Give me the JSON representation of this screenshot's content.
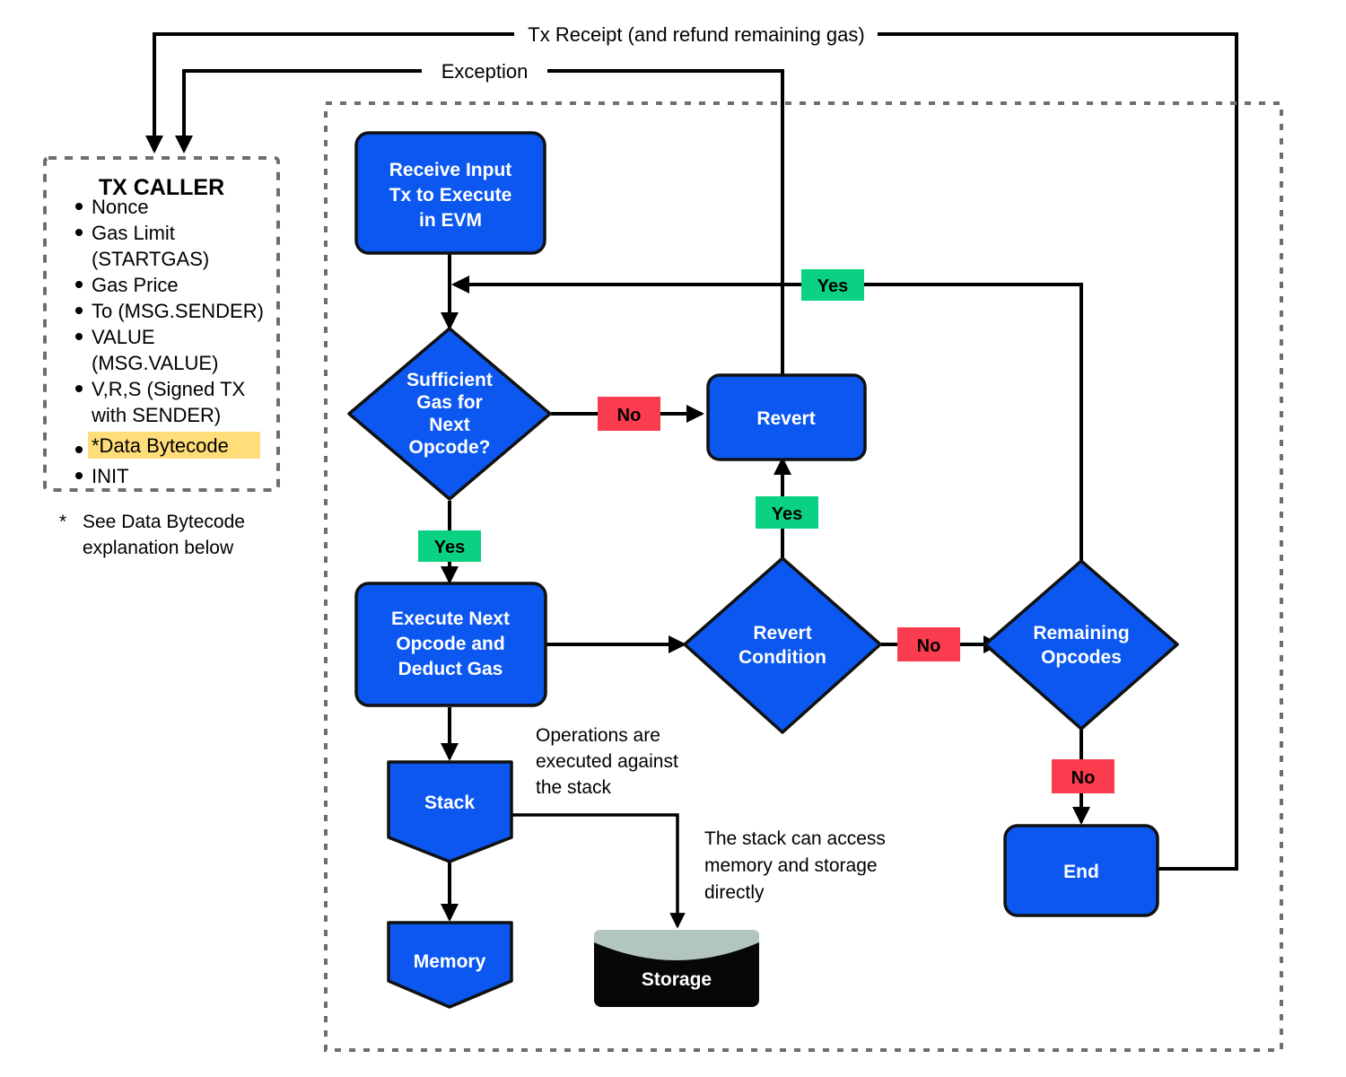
{
  "diagram": {
    "title": "EVM Transaction Execution Flowchart",
    "colors": {
      "node_blue": "#0B57F0",
      "yes_green": "#0BD183",
      "no_red": "#FB3B4E",
      "storage_black": "#070707",
      "storage_top": "#B3C5C1",
      "highlight_yellow": "#FFDE7A",
      "dotted_border": "#6E6E6E",
      "stroke_black": "#111111"
    }
  },
  "tx_caller": {
    "title": "TX CALLER",
    "items": [
      "Nonce",
      "Gas Limit (STARTGAS)",
      "Gas Price",
      "To (MSG.SENDER)",
      "VALUE (MSG.VALUE)",
      "V,R,S (Signed TX with SENDER)",
      "*Data Bytecode",
      "INIT"
    ],
    "item_lines": [
      [
        "Nonce"
      ],
      [
        "Gas Limit",
        "(STARTGAS)"
      ],
      [
        "Gas Price"
      ],
      [
        "To (MSG.SENDER)"
      ],
      [
        "VALUE",
        "(MSG.VALUE)"
      ],
      [
        "V,R,S (Signed TX",
        "with SENDER)"
      ],
      [
        "*Data Bytecode"
      ],
      [
        "INIT"
      ]
    ],
    "highlighted_item": "*Data Bytecode",
    "footnote_marker": "*",
    "footnote_lines": [
      "See Data Bytecode",
      "explanation below"
    ]
  },
  "nodes": {
    "receive_input": {
      "lines": [
        "Receive Input",
        "Tx to Execute",
        "in EVM"
      ],
      "shape": "rounded-rect"
    },
    "sufficient_gas": {
      "lines": [
        "Sufficient",
        "Gas for",
        "Next",
        "Opcode?"
      ],
      "shape": "diamond"
    },
    "execute_opcode": {
      "lines": [
        "Execute Next",
        "Opcode and",
        "Deduct Gas"
      ],
      "shape": "rounded-rect"
    },
    "revert": {
      "lines": [
        "Revert"
      ],
      "shape": "rounded-rect"
    },
    "revert_condition": {
      "lines": [
        "Revert",
        "Condition"
      ],
      "shape": "diamond"
    },
    "remaining_opcodes": {
      "lines": [
        "Remaining",
        "Opcodes"
      ],
      "shape": "diamond"
    },
    "end": {
      "lines": [
        "End"
      ],
      "shape": "rounded-rect"
    },
    "stack": {
      "lines": [
        "Stack"
      ],
      "shape": "pentagon-down"
    },
    "memory": {
      "lines": [
        "Memory"
      ],
      "shape": "pentagon-down"
    },
    "storage": {
      "lines": [
        "Storage"
      ],
      "shape": "cylinder"
    }
  },
  "edge_labels": {
    "gas_no": "No",
    "gas_yes": "Yes",
    "revert_condition_yes": "Yes",
    "revert_condition_no": "No",
    "remaining_opcodes_yes": "Yes",
    "remaining_opcodes_no": "No"
  },
  "route_labels": {
    "tx_receipt": "Tx Receipt (and refund remaining gas)",
    "exception": "Exception"
  },
  "annotations": {
    "stack_note": [
      "Operations are",
      "executed against",
      "the stack"
    ],
    "storage_note": [
      "The stack can access",
      "memory and storage",
      "directly"
    ]
  }
}
